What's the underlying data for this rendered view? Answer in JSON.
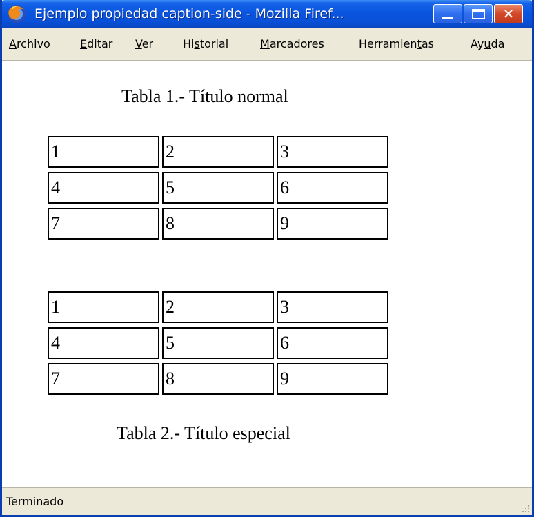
{
  "window": {
    "title": "Ejemplo propiedad caption-side - Mozilla Firef...",
    "icons": {
      "app": "firefox-icon",
      "minimize": "minimize-icon",
      "maximize": "maximize-icon",
      "close": "close-icon"
    },
    "close_glyph": "✕"
  },
  "menubar": {
    "items": [
      {
        "accel": "A",
        "rest": "rchivo"
      },
      {
        "accel": "E",
        "rest": "ditar"
      },
      {
        "accel": "V",
        "rest": "er"
      },
      {
        "pre": "Hi",
        "accel": "s",
        "rest": "torial"
      },
      {
        "accel": "M",
        "rest": "arcadores"
      },
      {
        "pre": "Herramien",
        "accel": "t",
        "rest": "as"
      },
      {
        "pre": "Ay",
        "accel": "u",
        "rest": "da"
      }
    ]
  },
  "tables": [
    {
      "caption": "Tabla 1.- Título normal",
      "caption_side": "top",
      "rows": [
        [
          "1",
          "2",
          "3"
        ],
        [
          "4",
          "5",
          "6"
        ],
        [
          "7",
          "8",
          "9"
        ]
      ]
    },
    {
      "caption": "Tabla 2.- Título especial",
      "caption_side": "bottom",
      "rows": [
        [
          "1",
          "2",
          "3"
        ],
        [
          "4",
          "5",
          "6"
        ],
        [
          "7",
          "8",
          "9"
        ]
      ]
    }
  ],
  "statusbar": {
    "text": "Terminado",
    "grip_icon": "resize-grip-icon"
  },
  "colors": {
    "titlebar": "#0a55e0",
    "close_button": "#d2492a",
    "chrome": "#ece9d8"
  }
}
